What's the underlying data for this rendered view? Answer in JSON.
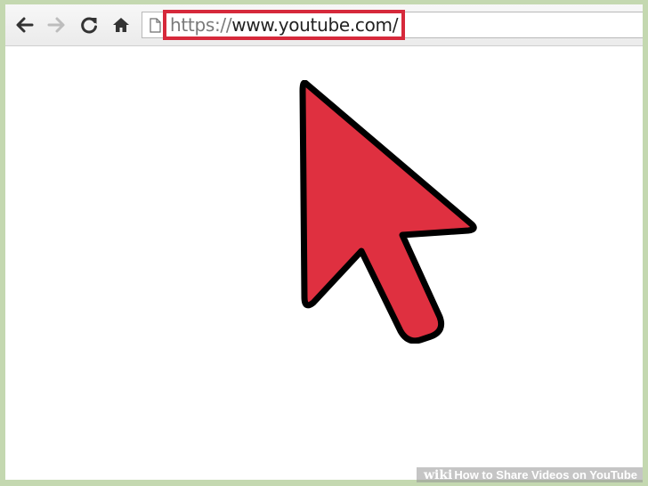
{
  "browser": {
    "back_icon": "arrow-left-icon",
    "forward_icon": "arrow-right-icon",
    "reload_icon": "reload-icon",
    "home_icon": "home-icon",
    "page_icon": "page-icon",
    "url_scheme": "https://",
    "url_host": "www.youtube.com/",
    "highlight_color": "#d6293b"
  },
  "cursor": {
    "icon": "pointer-arrow-icon",
    "fill": "#df3040",
    "outline": "#000000"
  },
  "watermark": {
    "logo": "wiki",
    "title_bold": "How",
    "title_rest": " to Share Videos on YouTube"
  }
}
